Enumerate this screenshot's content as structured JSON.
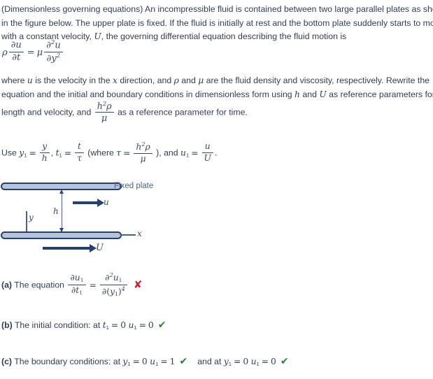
{
  "problem": {
    "paragraph1_part1": "(Dimensionless governing equations) An incompressible fluid is contained between two large parallel plates as shown in the figure below. The upper plate is fixed. If the fluid is initially at rest and the bottom plate suddenly starts to move with a constant velocity, ",
    "var_U": "U",
    "paragraph1_part2": ", the governing differential equation describing the fluid motion is",
    "equation_main": {
      "lhs_rho": "ρ",
      "lhs_num": "∂u",
      "lhs_den": "∂t",
      "equals": "=",
      "rhs_mu": "μ",
      "rhs_num_d": "∂",
      "rhs_num_exp": "2",
      "rhs_num_u": "u",
      "rhs_den_d": "∂y",
      "rhs_den_exp": "2"
    },
    "paragraph2_part1": "where ",
    "p2_u": "u",
    "paragraph2_part2": " is the velocity in the ",
    "p2_x": "x",
    "paragraph2_part3": " direction, and ",
    "p2_rho": "ρ",
    "paragraph2_part4": " and ",
    "p2_mu": "μ",
    "paragraph2_part5": " are the fluid density and viscosity, respectively. Rewrite the equation and the initial and boundary conditions in dimensionless form using ",
    "p2_h": "h",
    "paragraph2_part6": " and ",
    "p2_U": "U",
    "paragraph2_part7": " as reference parameters for length and velocity, and ",
    "ref_frac_num_h": "h",
    "ref_frac_num_exp": "2",
    "ref_frac_num_rho": "ρ",
    "ref_frac_den": "μ",
    "paragraph2_part8": " as a reference parameter for time."
  },
  "use_line": {
    "prefix": "Use ",
    "y1": "y",
    "y1_sub": "1",
    "eq1": "=",
    "frac1_num": "y",
    "frac1_den": "h",
    "comma": ", ",
    "t1": "t",
    "t1_sub": "1",
    "eq2": "=",
    "frac2_num": "t",
    "frac2_den": "τ",
    "where_open": " (where ",
    "tau": "τ",
    "eq3": "=",
    "frac3_num_h": "h",
    "frac3_num_exp": "2",
    "frac3_num_rho": "ρ",
    "frac3_den": "μ",
    "close_and": " ), and ",
    "u1": "u",
    "u1_sub": "1",
    "eq4": "=",
    "frac4_num": "u",
    "frac4_den": "U",
    "period": "."
  },
  "figure": {
    "fixed_plate_label": "Fixed plate",
    "h_label": "h",
    "y_label": "y",
    "x_label": "x",
    "u_arrow_label": "u",
    "U_arrow_label": "U",
    "plate_fill_color": "#b6c3dc",
    "plate_edge_color": "#26406e",
    "arrow_color": "#26406e",
    "label_color": "#50637f"
  },
  "answers": {
    "a": {
      "tag": "(a)",
      "text": "The equation",
      "lhs_num_d": "∂u",
      "lhs_num_sub": "1",
      "lhs_den_d": "∂t",
      "lhs_den_sub": "1",
      "equals": "=",
      "rhs_num_d": "∂",
      "rhs_num_exp": "2",
      "rhs_num_u": "u",
      "rhs_num_sub": "1",
      "rhs_den_d": "∂",
      "rhs_den_open": "(",
      "rhs_den_y": "y",
      "rhs_den_sub": "1",
      "rhs_den_close": ")",
      "rhs_den_exp": "4",
      "mark": "✘",
      "mark_status": "incorrect",
      "mark_color": "#cc2229"
    },
    "b": {
      "tag": "(b)",
      "text": "The initial condition: at ",
      "t1": "t",
      "t1_sub": "1",
      "eq1": "=",
      "val1": "0",
      "u1": "u",
      "u1_sub": "1",
      "eq2": "=",
      "val2": "0",
      "mark": "✔",
      "mark_status": "correct",
      "mark_color": "#2e7d32"
    },
    "c": {
      "tag": "(c)",
      "text": "The boundary conditions: at ",
      "y1a": "y",
      "y1a_sub": "1",
      "eq1a": "=",
      "val1a": "0",
      "u1a": "u",
      "u1a_sub": "1",
      "eq2a": "=",
      "val2a": "1",
      "mark_a": "✔",
      "connector": "and  at ",
      "y1b": "y",
      "y1b_sub": "1",
      "eq1b": "=",
      "val1b": "0",
      "u1b": "u",
      "u1b_sub": "1",
      "eq2b": "=",
      "val2b": "0",
      "mark_b": "✔",
      "mark_status": "correct",
      "mark_color": "#2e7d32"
    }
  }
}
